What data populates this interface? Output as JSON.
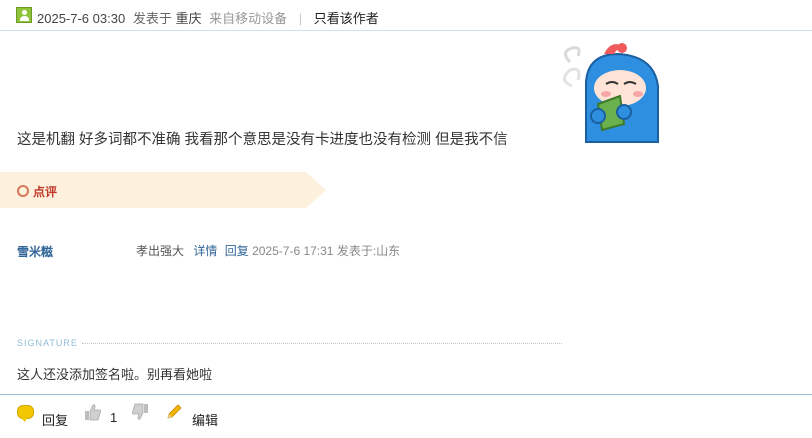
{
  "post": {
    "date": "2025-7-6 03:30",
    "posted_in": "发表于",
    "location": "重庆",
    "via": "来自移动设备",
    "separator": "|",
    "only_author": "只看该作者",
    "text": "这是机翻 好多词都不准确 我看那个意思是没有卡进度也没有检测  但是我不信"
  },
  "comments_section": {
    "label": "点评",
    "items": [
      {
        "user": "雪米糍",
        "text": "孝出强大",
        "details_link": "详情",
        "reply_link": "回复",
        "date": "2025-7-6 17:31",
        "from": "发表于:山东"
      }
    ]
  },
  "signature": {
    "label": "SIGNATURE",
    "text": "这人还没添加签名啦。别再看她啦"
  },
  "actions": {
    "reply": "回复",
    "like_count": "1",
    "edit": "编辑"
  },
  "colors": {
    "link": "#336699",
    "comment_label": "#c0392b",
    "banner": "#fdf0dc",
    "border": "#9fc2d6"
  }
}
